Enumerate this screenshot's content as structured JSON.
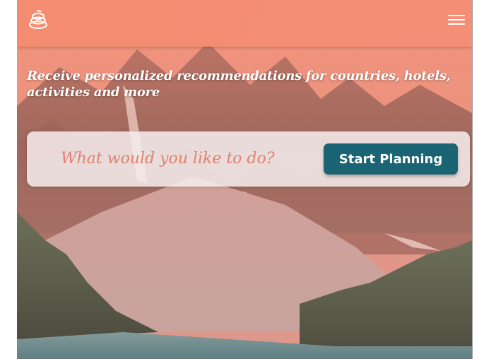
{
  "navbar": {
    "logo_icon": "globe-stack-icon",
    "menu_icon": "hamburger-menu-icon"
  },
  "hero": {
    "tagline": "Receive personalized recommendations for countries, hotels, activities and more",
    "background": "mountain-lake-landscape"
  },
  "search": {
    "placeholder": "What would you like to do?",
    "value": "",
    "button_label": "Start Planning"
  },
  "colors": {
    "navbar": "#f48c70",
    "accent_button": "#1b6473",
    "placeholder_text": "#e2806f"
  }
}
